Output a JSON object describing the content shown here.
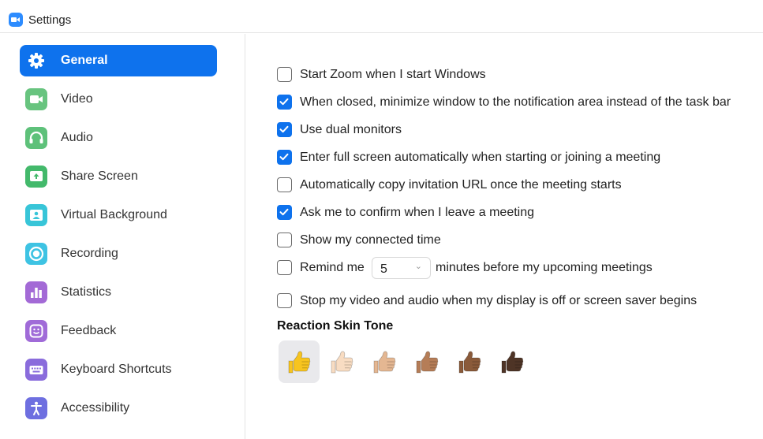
{
  "window": {
    "title": "Settings",
    "icon": "zoom-camera-icon"
  },
  "sidebar": {
    "items": [
      {
        "label": "General",
        "icon": "gear-icon",
        "color": "#0e72ed",
        "active": true
      },
      {
        "label": "Video",
        "icon": "video-camera-icon",
        "color": "#68c47f",
        "active": false
      },
      {
        "label": "Audio",
        "icon": "headphones-icon",
        "color": "#5ec17a",
        "active": false
      },
      {
        "label": "Share Screen",
        "icon": "share-screen-icon",
        "color": "#43b96b",
        "active": false
      },
      {
        "label": "Virtual Background",
        "icon": "virtual-background-icon",
        "color": "#38c5d8",
        "active": false
      },
      {
        "label": "Recording",
        "icon": "recording-icon",
        "color": "#3ec3e3",
        "active": false
      },
      {
        "label": "Statistics",
        "icon": "statistics-icon",
        "color": "#a36ad6",
        "active": false
      },
      {
        "label": "Feedback",
        "icon": "feedback-smiley-icon",
        "color": "#a06bd8",
        "active": false
      },
      {
        "label": "Keyboard Shortcuts",
        "icon": "keyboard-icon",
        "color": "#8a6cdc",
        "active": false
      },
      {
        "label": "Accessibility",
        "icon": "accessibility-icon",
        "color": "#6e6fe0",
        "active": false
      }
    ]
  },
  "general": {
    "options": [
      {
        "label": "Start Zoom when I start Windows",
        "checked": false
      },
      {
        "label": "When closed, minimize window to the notification area instead of the task bar",
        "checked": true
      },
      {
        "label": "Use dual monitors",
        "checked": true
      },
      {
        "label": "Enter full screen automatically when starting or joining a meeting",
        "checked": true
      },
      {
        "label": "Automatically copy invitation URL once the meeting starts",
        "checked": false
      },
      {
        "label": "Ask me to confirm when I leave a meeting",
        "checked": true
      },
      {
        "label": "Show my connected time",
        "checked": false
      }
    ],
    "remind": {
      "checked": false,
      "label_before": "Remind me",
      "value": "5",
      "label_after": "minutes before my upcoming meetings"
    },
    "stop_video": {
      "label": "Stop my video and audio when my display is off or screen saver begins",
      "checked": false
    },
    "reaction_skin_tone": {
      "title": "Reaction Skin Tone",
      "selected_index": 0,
      "tones": [
        {
          "name": "default-yellow",
          "color": "#f7c41f"
        },
        {
          "name": "light",
          "color": "#f8dcc2"
        },
        {
          "name": "medium-light",
          "color": "#e4b792"
        },
        {
          "name": "medium",
          "color": "#b57d57"
        },
        {
          "name": "medium-dark",
          "color": "#8a5a3a"
        },
        {
          "name": "dark",
          "color": "#4e3426"
        }
      ]
    }
  }
}
